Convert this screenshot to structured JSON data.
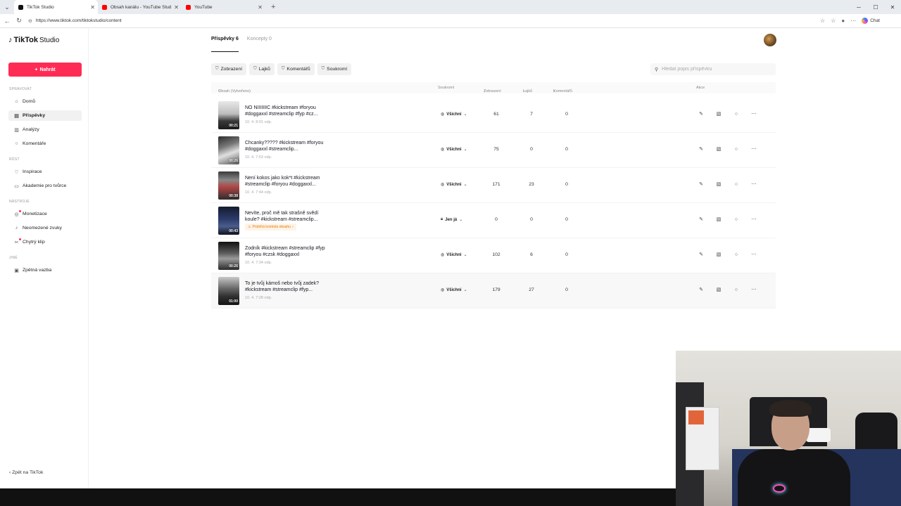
{
  "browser": {
    "tabs": [
      {
        "title": "TikTok Studio",
        "active": true,
        "favicon": "tiktok-icon"
      },
      {
        "title": "Obsah kanálu - YouTube Studio",
        "active": false,
        "favicon": "youtube-icon"
      },
      {
        "title": "YouTube",
        "active": false,
        "favicon": "youtube-icon"
      }
    ],
    "url": "https://www.tiktok.com/tiktokstudio/content",
    "chat_label": "Chat"
  },
  "sidebar": {
    "logo_brand": "TikTok",
    "logo_product": "Studio",
    "upload_label": "Nahrát",
    "sections": {
      "manage": "SPRAVOVAT",
      "grow": "RŮST",
      "earn": "NÁSTROJE",
      "other": "JINÉ"
    },
    "items": [
      {
        "label": "Domů",
        "icon": "home-icon"
      },
      {
        "label": "Příspěvky",
        "icon": "posts-icon",
        "active": true
      },
      {
        "label": "Analýzy",
        "icon": "analytics-icon"
      },
      {
        "label": "Komentáře",
        "icon": "comments-icon"
      },
      {
        "label": "Inspirace",
        "icon": "inspiration-icon"
      },
      {
        "label": "Akademie pro tvůrce",
        "icon": "academy-icon"
      },
      {
        "label": "Monetizace",
        "icon": "monetization-icon"
      },
      {
        "label": "Neomezené zvuky",
        "icon": "music-icon"
      },
      {
        "label": "Chytrý klip",
        "icon": "smart-clip-icon"
      },
      {
        "label": "Zpětná vazba",
        "icon": "feedback-icon"
      }
    ],
    "back_label": "Zpět na TikTok"
  },
  "content_tabs": [
    {
      "label": "Příspěvky 6",
      "active": true
    },
    {
      "label": "Koncepty 0",
      "active": false
    }
  ],
  "filters": [
    "Zobrazení",
    "Lajků",
    "Komentářů",
    "Soukromí"
  ],
  "search": {
    "placeholder": "Hledat popis příspěvku"
  },
  "table": {
    "headers": {
      "content": "Obsah (Vytvořeno)",
      "privacy": "Soukromí",
      "views": "Zobrazení",
      "likes": "Lajků",
      "comments": "Komentářů",
      "actions": "Akce"
    },
    "rows": [
      {
        "title": "NO NIIIIIIIC #kickstream #foryou #doggaxxl #streamclip #fyp #cz...",
        "date": "10. 4. 8:01 odp.",
        "duration": "00:21",
        "privacy": "Všichni",
        "views": "61",
        "likes": "7",
        "comments": "0",
        "warning": ""
      },
      {
        "title": "Chcanky????? #kickstream #foryou #doggaxxl #streamclip...",
        "date": "10. 4. 7:53 odp.",
        "duration": "00:26",
        "privacy": "Všichni",
        "views": "75",
        "likes": "0",
        "comments": "0",
        "warning": ""
      },
      {
        "title": "Není kokos jako kok*t #kickstream #streamclip #foryou #doggaxxl...",
        "date": "10. 4. 7:44 odp.",
        "duration": "00:38",
        "privacy": "Všichni",
        "views": "171",
        "likes": "23",
        "comments": "0",
        "warning": ""
      },
      {
        "title": "Nevíte, proč mě tak strašně svědí koule? #kickstream #streamclip...",
        "date": "",
        "duration": "00:43",
        "privacy": "Jen já",
        "views": "0",
        "likes": "0",
        "comments": "0",
        "warning": "Probíhá kontrola obsahu"
      },
      {
        "title": "Zodník #kickstream #streamclip #fyp #foryou #czsk #doggaxxl",
        "date": "10. 4. 7:34 odp.",
        "duration": "00:26",
        "privacy": "Všichni",
        "views": "102",
        "likes": "6",
        "comments": "0",
        "warning": ""
      },
      {
        "title": "To je tvůj kámoš nebo tvůj zadek? #kickstream #streamclip #fyp...",
        "date": "10. 4. 7:28 odp.",
        "duration": "01:00",
        "privacy": "Všichni",
        "views": "179",
        "likes": "27",
        "comments": "0",
        "warning": ""
      }
    ]
  },
  "colors": {
    "accent": "#fe2c55",
    "warning": "#e07b00"
  }
}
